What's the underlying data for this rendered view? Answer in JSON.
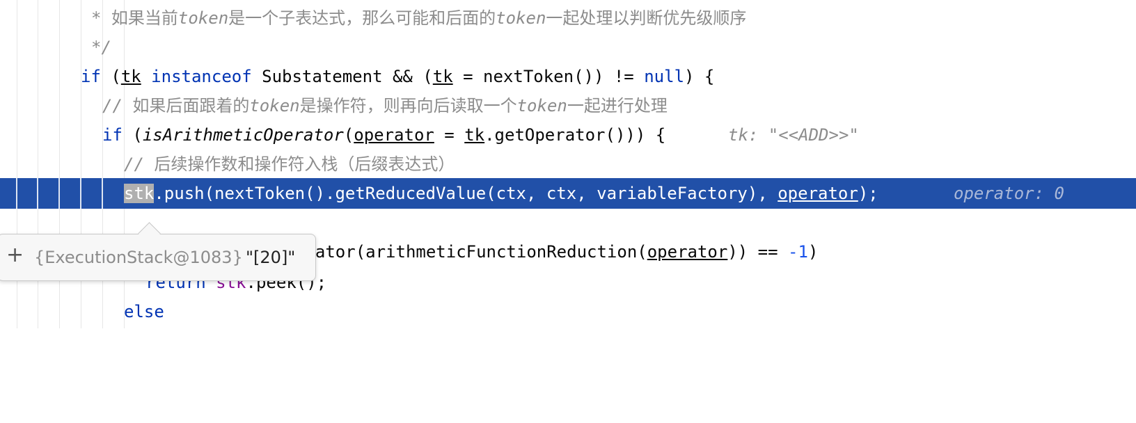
{
  "editor": {
    "lines": {
      "l1": {
        "star": "* ",
        "t1": "如果当前",
        "t2": "token",
        "t3": "是一个子表达式，那么可能和后面的",
        "t4": "token",
        "t5": "一起处理以判断优先级顺序"
      },
      "l2": {
        "text": "*/"
      },
      "l3": {
        "kw_if": "if",
        "p1": " (",
        "tk1": "tk",
        "sp1": " ",
        "kw_inst": "instanceof",
        "p2": " Substatement && (",
        "tk2": "tk",
        "p3": " = nextToken()) != ",
        "kw_null": "null",
        "p4": ") {"
      },
      "l4": {
        "slashes": "// ",
        "t1": "如果后面跟着的",
        "t2": "token",
        "t3": "是操作符，则再向后读取一个",
        "t4": "token",
        "t5": "一起进行处理"
      },
      "l5": {
        "kw_if": "if",
        "p1": " (",
        "method": "isArithmeticOperator",
        "p2": "(",
        "op": "operator",
        "p3": " = ",
        "tk": "tk",
        "p4": ".getOperator())) {",
        "hint": "tk: \"<<ADD>>\""
      },
      "l6": {
        "slashes": "// ",
        "text": "后续操作数和操作符入栈（后缀表达式）"
      },
      "l7": {
        "stk": "stk",
        "p1": ".push(nextToken().getReducedValue(ctx, ctx, variableFactory), ",
        "op": "operator",
        "p2": ");",
        "hint": "operator: 0"
      },
      "l9": {
        "partial": "erator(arithmeticFunctionReduction(",
        "op": "operator",
        "p1": ")) == ",
        "num": "-1",
        "p2": ")"
      },
      "l10": {
        "kw_return": "return",
        "sp": " ",
        "stk": "stk",
        "p1": ".peek();"
      },
      "l11": {
        "kw_else": "else"
      }
    }
  },
  "debug_popup": {
    "expand_icon": "plus-icon",
    "object_label": "{ExecutionStack@1083}",
    "value": "\"[20]\""
  }
}
